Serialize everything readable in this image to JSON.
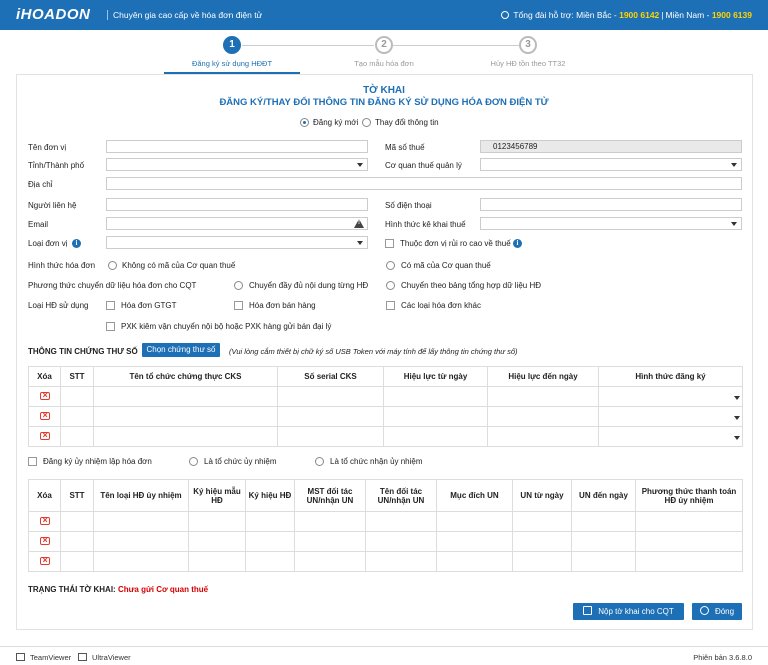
{
  "header": {
    "logo": "iHOADON",
    "tagline": "Chuyên gia cao cấp về hóa đơn điện tử",
    "hotline_label": "Tổng đài hỗ trợ: Miền Bắc -",
    "phone_north": "1900 6142",
    "south_label": "Miền Nam -",
    "phone_south": "1900 6139"
  },
  "steps": [
    {
      "num": "1",
      "label": "Đăng ký sử dụng HĐĐT"
    },
    {
      "num": "2",
      "label": "Tạo mẫu hóa đơn"
    },
    {
      "num": "3",
      "label": "Hủy HĐ tồn theo TT32"
    }
  ],
  "form": {
    "title1": "TỜ KHAI",
    "title2": "ĐĂNG KÝ/THAY ĐỔI THÔNG TIN ĐĂNG KÝ SỬ DỤNG HÓA ĐƠN ĐIỆN TỬ",
    "radio_new": "Đăng ký mới",
    "radio_change": "Thay đổi thông tin",
    "ten_don_vi": "Tên đơn vị",
    "ma_so_thue": "Mã số thuế",
    "ma_so_thue_value": "0123456789",
    "tinh_thanh": "Tỉnh/Thành phố",
    "co_quan_thue": "Cơ quan thuế quản lý",
    "dia_chi": "Địa chỉ",
    "nguoi_lien_he": "Người liên hệ",
    "so_dien_thoai": "Số điện thoại",
    "email": "Email",
    "hinh_thuc_ke_khai": "Hình thức kê khai thuế",
    "loai_don_vi": "Loại đơn vị",
    "rui_ro": "Thuộc đơn vị rủi ro cao về thuế",
    "hinh_thuc_hoa_don": "Hình thức hóa đơn",
    "khong_co_ma": "Không có mã của Cơ quan thuế",
    "co_ma": "Có mã của Cơ quan thuế",
    "phuong_thuc": "Phương thức chuyển dữ liệu hóa đơn cho CQT",
    "day_du": "Chuyển đầy đủ nội dung từng HĐ",
    "bang_tong_hop": "Chuyển theo bảng tổng hợp dữ liệu HĐ",
    "loai_hd": "Loại HĐ sử dụng",
    "gtgt": "Hóa đơn GTGT",
    "ban_hang": "Hóa đơn bán hàng",
    "khac": "Các loại hóa đơn khác",
    "pxk": "PXK kiêm vận chuyển nội bộ hoặc PXK hàng gửi bán đại lý"
  },
  "cert": {
    "section": "THÔNG TIN CHỨNG THƯ SỐ",
    "button": "Chọn chứng thư số",
    "note": "(Vui lòng cắm thiết bị chữ ký số USB Token với máy tính để lấy thông tin chứng thư số)",
    "headers": [
      "Xóa",
      "STT",
      "Tên tổ chức chứng thực CKS",
      "Số serial CKS",
      "Hiệu lực từ ngày",
      "Hiệu lực đến ngày",
      "Hình thức đăng ký"
    ]
  },
  "delegate": {
    "checkbox": "Đăng ký ủy nhiệm lập hóa đơn",
    "radio_org": "Là tổ chức ủy nhiệm",
    "radio_recv": "Là tổ chức nhận ủy nhiệm",
    "headers": [
      "Xóa",
      "STT",
      "Tên loại HĐ ủy nhiệm",
      "Ký hiệu mẫu HĐ",
      "Ký hiệu HĐ",
      "MST đối tác UN/nhận UN",
      "Tên đối tác UN/nhận UN",
      "Mục đích UN",
      "UN từ ngày",
      "UN đến ngày",
      "Phương thức thanh toán HĐ ủy nhiệm"
    ]
  },
  "status": {
    "label": "TRẠNG THÁI TỜ KHAI:",
    "value": "Chưa gửi Cơ quan thuế"
  },
  "buttons": {
    "submit": "Nộp tờ khai cho CQT",
    "close": "Đóng"
  },
  "footer": {
    "teamviewer": "TeamViewer",
    "ultraviewer": "UltraViewer",
    "version": "Phiên bản 3.6.8.0"
  }
}
